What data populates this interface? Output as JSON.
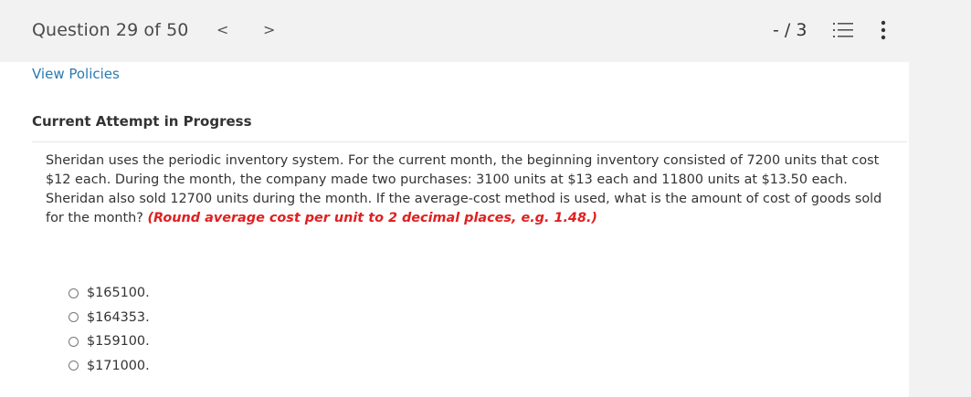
{
  "header": {
    "question_counter": "Question 29 of 50",
    "prev_label": "<",
    "next_label": ">",
    "score": "- / 3",
    "list_icon": "list-numbered-icon",
    "more_icon": "vertical-ellipsis-icon"
  },
  "content": {
    "view_policies": "View Policies",
    "attempt_status": "Current Attempt in Progress",
    "question_text": "Sheridan uses the periodic inventory system. For the current month, the beginning inventory consisted of 7200 units that cost $12 each. During the month, the company made two purchases: 3100 units at $13 each and 11800 units at $13.50 each. Sheridan also sold 12700 units during the month. If the average-cost method is used, what is the amount of cost of goods sold for the month? ",
    "question_hint": "(Round average cost per unit to 2 decimal places, e.g. 1.48.)",
    "options": [
      {
        "label": "$165100."
      },
      {
        "label": "$164353."
      },
      {
        "label": "$159100."
      },
      {
        "label": "$171000."
      }
    ]
  },
  "colors": {
    "link": "#2a7ab0",
    "hint": "#e02020",
    "header_bg": "#f2f2f2",
    "content_bg": "#ffffff"
  }
}
